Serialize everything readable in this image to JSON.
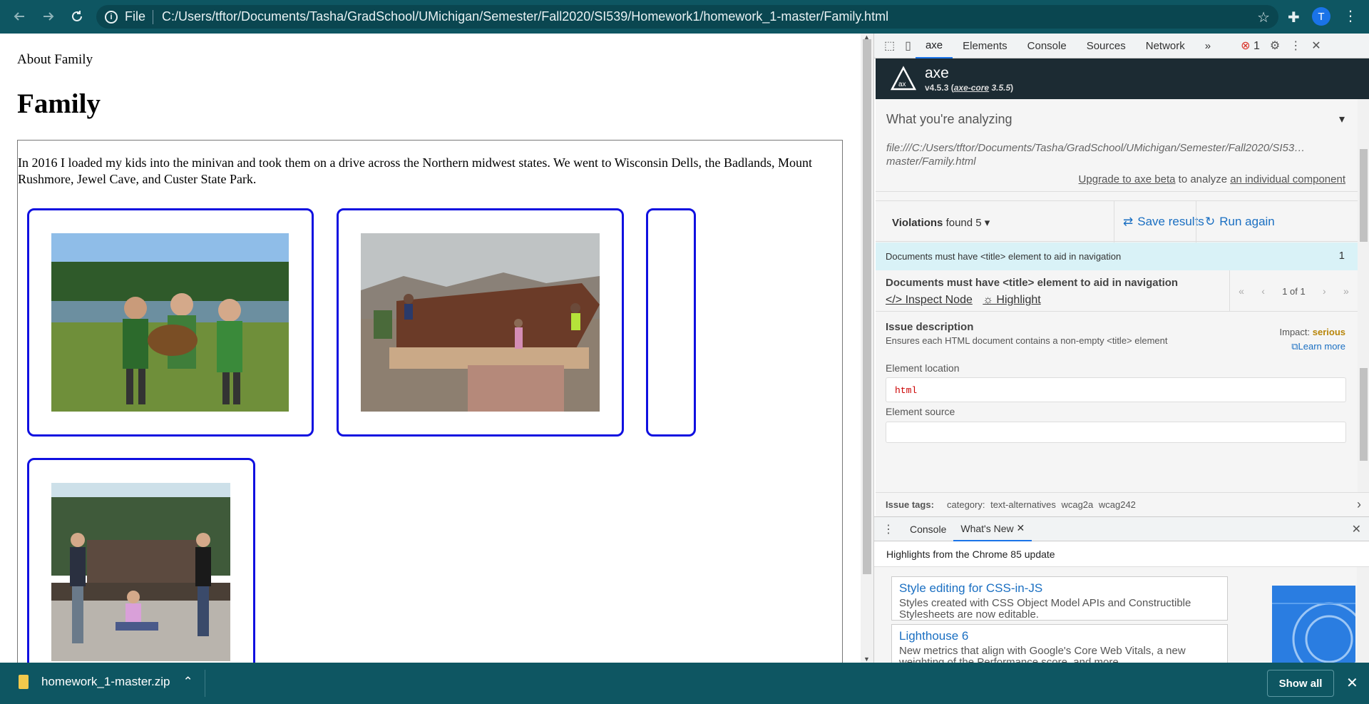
{
  "browser": {
    "scheme": "File",
    "url": "C:/Users/tftor/Documents/Tasha/GradSchool/UMichigan/Semester/Fall2020/SI539/Homework1/homework_1-master/Family.html",
    "profile_initial": "T"
  },
  "page": {
    "about_link": "About Family",
    "heading": "Family",
    "intro": "In 2016 I loaded my kids into the minivan and took them on a drive across the Northern midwest states. We went to Wisconsin Dells, the Badlands, Mount Rushmore, Jewel Cave, and Custer State Park."
  },
  "devtools": {
    "tabs": [
      "axe",
      "Elements",
      "Console",
      "Sources",
      "Network"
    ],
    "more_tabs": "»",
    "error_count": "1",
    "axe": {
      "name": "axe",
      "version": "v4.5.3",
      "core_label": "axe-core",
      "core_version": "3.5.5",
      "analyzing_title": "What you're analyzing",
      "analyzing_url": "file:///C:/Users/tftor/Documents/Tasha/GradSchool/UMichigan/Semester/Fall2020/SI53… master/Family.html",
      "upgrade_link": "Upgrade to axe beta",
      "upgrade_mid": "to analyze",
      "upgrade_tail": "an individual component",
      "violations_label": "Violations",
      "violations_found": "found 5",
      "save_results": "Save results",
      "run_again": "Run again",
      "rule_title": "Documents must have <title> element to aid in navigation",
      "rule_count": "1",
      "inspect_node": "Inspect Node",
      "highlight": "Highlight",
      "pager": "1 of 1",
      "issue_heading": "Issue description",
      "issue_desc": "Ensures each HTML document contains a non-empty <title> element",
      "impact_label": "Impact:",
      "impact_value": "serious",
      "learn_more": "Learn more",
      "element_location": "Element location",
      "location_value": "html",
      "element_source": "Element source",
      "issue_tags_label": "Issue tags:",
      "issue_tags": "category: text-alternatives   wcag2a   wcag242"
    },
    "drawer": {
      "tabs": [
        "Console",
        "What's New"
      ],
      "highlights": "Highlights from the Chrome 85 update",
      "news": [
        {
          "title": "Style editing for CSS-in-JS",
          "desc": "Styles created with CSS Object Model APIs and Constructible Stylesheets are now editable."
        },
        {
          "title": "Lighthouse 6",
          "desc": "New metrics that align with Google's Core Web Vitals, a new weighting of the Performance score, and more."
        }
      ]
    }
  },
  "downloads": {
    "file": "homework_1-master.zip",
    "show_all": "Show all"
  }
}
